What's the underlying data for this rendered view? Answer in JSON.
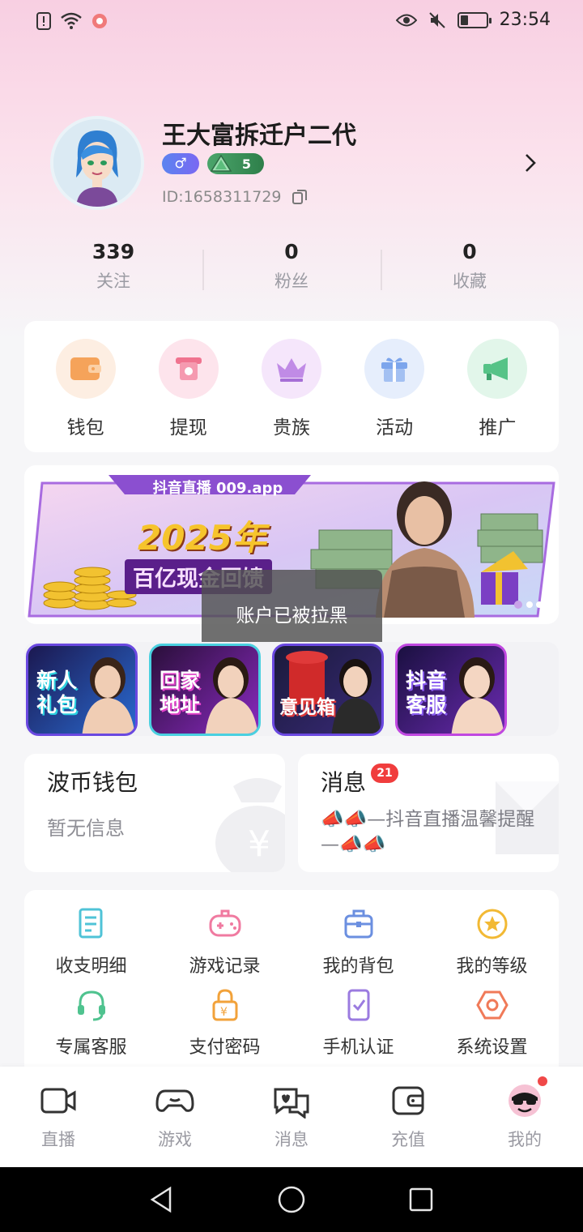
{
  "status_bar": {
    "time": "23:54",
    "battery_level": 0.3,
    "left_icons": [
      "alert-icon",
      "wifi-icon",
      "app-notification-icon"
    ],
    "right_icons": [
      "eye-icon",
      "mute-icon",
      "battery-icon"
    ]
  },
  "profile": {
    "username": "王大富拆迁户二代",
    "gender_symbol": "♂",
    "level": "5",
    "user_id": "ID:1658311729"
  },
  "stats": [
    {
      "value": "339",
      "label": "关注"
    },
    {
      "value": "0",
      "label": "粉丝"
    },
    {
      "value": "0",
      "label": "收藏"
    }
  ],
  "quick_actions": [
    {
      "label": "钱包",
      "icon": "wallet-icon",
      "bg": "#fdeee2",
      "color": "#f5a35a"
    },
    {
      "label": "提现",
      "icon": "withdraw-icon",
      "bg": "#fde4ec",
      "color": "#f0738f"
    },
    {
      "label": "贵族",
      "icon": "crown-icon",
      "bg": "#f5e6fb",
      "color": "#c08be6"
    },
    {
      "label": "活动",
      "icon": "gift-icon",
      "bg": "#e6eefc",
      "color": "#7ca5ec"
    },
    {
      "label": "推广",
      "icon": "megaphone-icon",
      "bg": "#e2f6ea",
      "color": "#56c387"
    }
  ],
  "banner": {
    "tag": "抖音直播 009.app",
    "headline": "2025年",
    "subline": "百亿现金回馈",
    "page_count": 4,
    "active_page": 0
  },
  "toast": "账户已被拉黑",
  "promo_tiles": [
    {
      "line1": "新人",
      "line2": "礼包",
      "accent": "#2bd1e0"
    },
    {
      "line1": "回家",
      "line2": "地址",
      "accent": "#e040c8"
    },
    {
      "line1": "意见箱",
      "line2": "",
      "accent": "#e03a3a"
    },
    {
      "line1": "抖音",
      "line2": "客服",
      "accent": "#8a5cf0"
    }
  ],
  "wallet_card": {
    "title": "波币钱包",
    "subtitle": "暂无信息"
  },
  "message_card": {
    "title": "消息",
    "badge": "21",
    "preview": "📣📣—抖音直播温馨提醒—📣📣"
  },
  "services": [
    {
      "label": "收支明细",
      "icon": "ledger-icon",
      "color": "#4fc3d7"
    },
    {
      "label": "游戏记录",
      "icon": "gamepad-icon",
      "color": "#f07aa0"
    },
    {
      "label": "我的背包",
      "icon": "backpack-icon",
      "color": "#6b8fe0"
    },
    {
      "label": "我的等级",
      "icon": "level-star-icon",
      "color": "#f2b934"
    },
    {
      "label": "专属客服",
      "icon": "headset-icon",
      "color": "#4fc38f"
    },
    {
      "label": "支付密码",
      "icon": "lock-icon",
      "color": "#f2a23a"
    },
    {
      "label": "手机认证",
      "icon": "phone-check-icon",
      "color": "#9b7be0"
    },
    {
      "label": "系统设置",
      "icon": "settings-icon",
      "color": "#f07a58"
    }
  ],
  "tabs": [
    {
      "label": "直播",
      "icon": "camera-icon"
    },
    {
      "label": "游戏",
      "icon": "controller-icon"
    },
    {
      "label": "消息",
      "icon": "chat-icon"
    },
    {
      "label": "充值",
      "icon": "wallet-tab-icon"
    },
    {
      "label": "我的",
      "icon": "avatar-tab-icon",
      "active": true
    }
  ],
  "nav": [
    "back-icon",
    "home-icon",
    "recents-icon"
  ]
}
